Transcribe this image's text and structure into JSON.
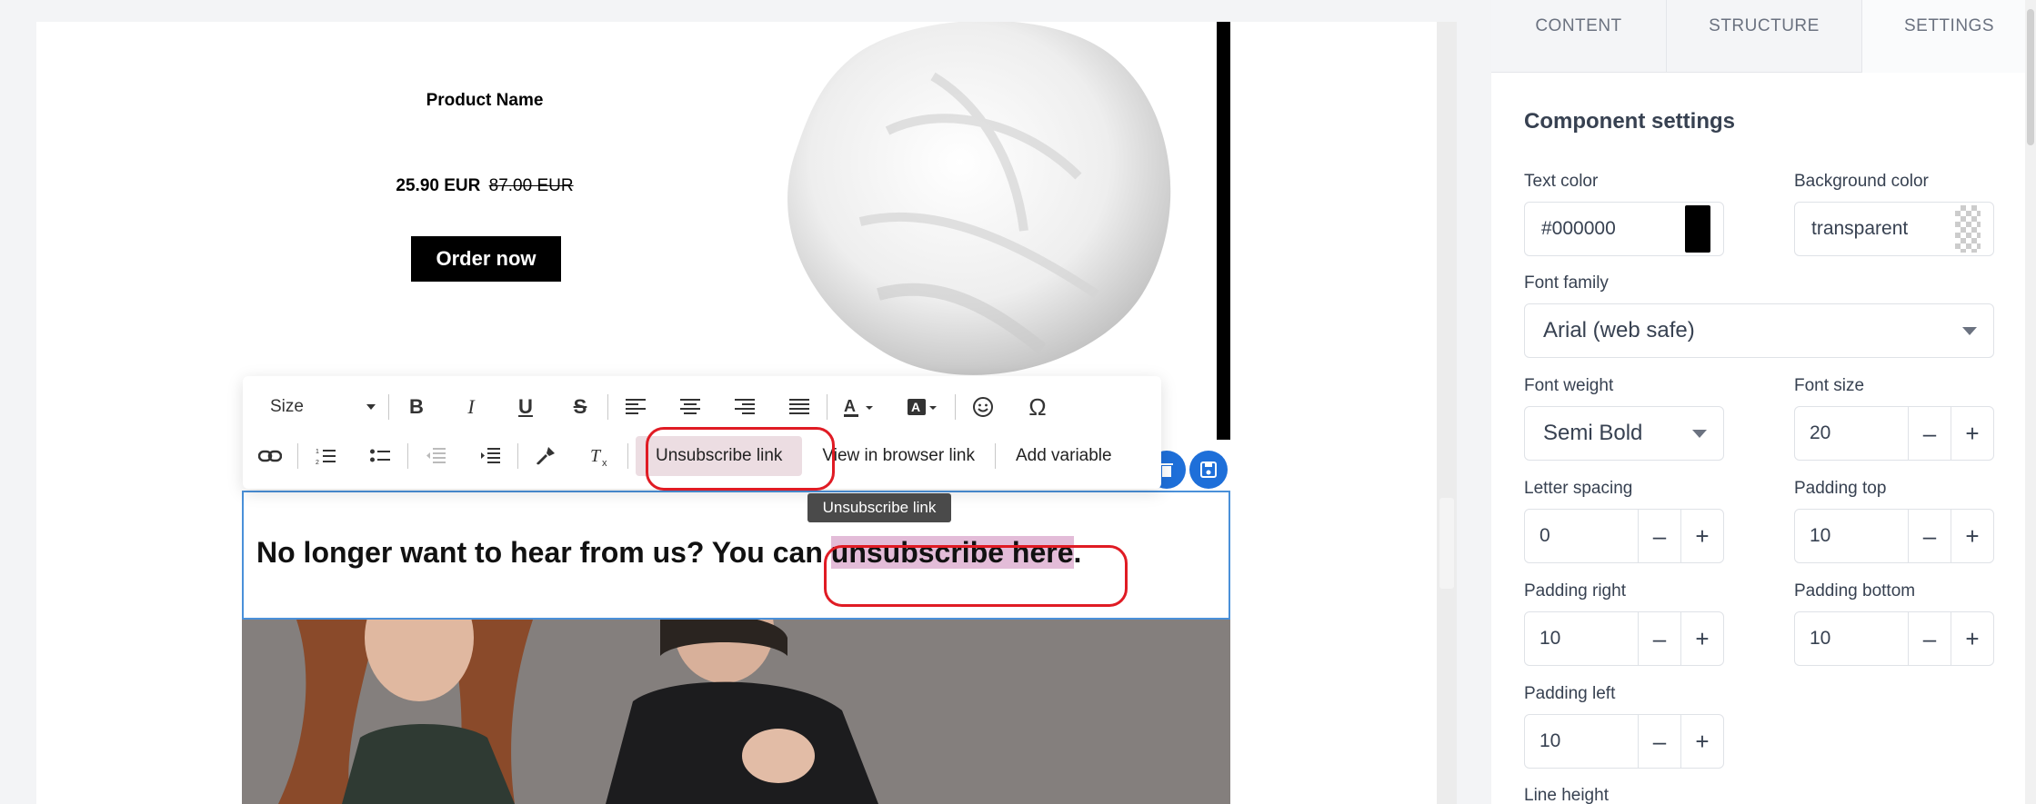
{
  "product": {
    "name": "Product Name",
    "price_current": "25.90 EUR",
    "price_old": "87.00 EUR",
    "order_label": "Order now"
  },
  "text_block": {
    "before": "No longer want to hear from us? You can ",
    "link": "unsubscribe here",
    "after": "."
  },
  "toolbar": {
    "size_label": "Size",
    "unsubscribe_label": "Unsubscribe link",
    "browser_label": "View in browser link",
    "variable_label": "Add variable",
    "tooltip": "Unsubscribe link"
  },
  "panel": {
    "tabs": [
      "CONTENT",
      "STRUCTURE",
      "SETTINGS"
    ],
    "title": "Component settings",
    "text_color": {
      "label": "Text color",
      "value": "#000000"
    },
    "background_color": {
      "label": "Background color",
      "value": "transparent"
    },
    "font_family": {
      "label": "Font family",
      "value": "Arial (web safe)"
    },
    "font_weight": {
      "label": "Font weight",
      "value": "Semi Bold"
    },
    "font_size": {
      "label": "Font size",
      "value": "20"
    },
    "letter_spacing": {
      "label": "Letter spacing",
      "value": "0"
    },
    "padding_top": {
      "label": "Padding top",
      "value": "10"
    },
    "padding_right": {
      "label": "Padding right",
      "value": "10"
    },
    "padding_bottom": {
      "label": "Padding bottom",
      "value": "10"
    },
    "padding_left": {
      "label": "Padding left",
      "value": "10"
    },
    "line_height": {
      "label": "Line height"
    },
    "stepper_minus": "–",
    "stepper_plus": "+"
  },
  "colors": {
    "accent": "#1e6fd9",
    "highlight": "#e01b24",
    "link_bg": "#e3bcd8"
  }
}
